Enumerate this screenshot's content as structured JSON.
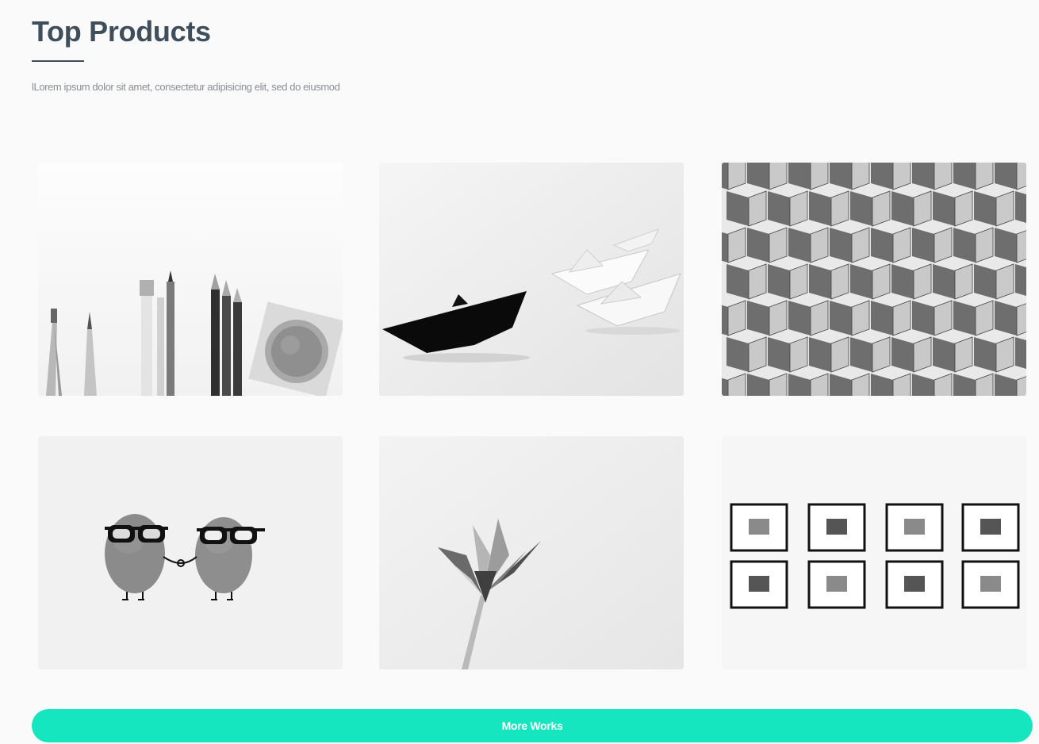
{
  "section": {
    "title": "Top Products",
    "description": "lLorem ipsum dolor sit amet, consectetur adipisicing elit, sed do eiusmod"
  },
  "products": [
    {
      "image": "art-supplies-photo"
    },
    {
      "image": "paper-boats-photo"
    },
    {
      "image": "geometric-facade-photo"
    },
    {
      "image": "stones-with-glasses-photo"
    },
    {
      "image": "origami-flower-photo"
    },
    {
      "image": "framed-pictures-wall-photo"
    }
  ],
  "cta": {
    "label": "More Works"
  },
  "colors": {
    "accent": "#15e6bf",
    "heading": "#3e4e5a",
    "text_muted": "#8a8f95",
    "background": "#fafafa"
  }
}
